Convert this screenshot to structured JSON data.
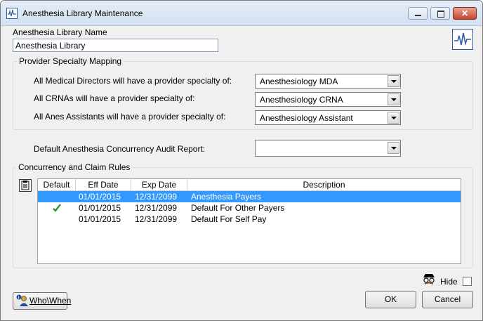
{
  "window": {
    "title": "Anesthesia Library Maintenance"
  },
  "library": {
    "name_label": "Anesthesia Library Name",
    "name_value": "Anesthesia Library"
  },
  "mapping": {
    "group_title": "Provider Specialty Mapping",
    "rows": [
      {
        "label": "All Medical Directors will have a provider specialty of:",
        "value": "Anesthesiology MDA"
      },
      {
        "label": "All CRNAs will have a provider specialty of:",
        "value": "Anesthesiology CRNA"
      },
      {
        "label": "All Anes Assistants will have a provider specialty of:",
        "value": "Anesthesiology Assistant"
      }
    ]
  },
  "audit": {
    "label": "Default Anesthesia Concurrency Audit Report:",
    "value": ""
  },
  "rules": {
    "group_title": "Concurrency and Claim Rules",
    "columns": [
      "Default",
      "Eff Date",
      "Exp Date",
      "Description"
    ],
    "rows": [
      {
        "default": false,
        "eff": "01/01/2015",
        "exp": "12/31/2099",
        "desc": "Anesthesia Payers",
        "selected": true
      },
      {
        "default": true,
        "eff": "01/01/2015",
        "exp": "12/31/2099",
        "desc": "Default For Other Payers",
        "selected": false
      },
      {
        "default": false,
        "eff": "01/01/2015",
        "exp": "12/31/2099",
        "desc": "Default For Self Pay",
        "selected": false
      }
    ]
  },
  "footer": {
    "hide_label": "Hide",
    "whowhen_label": "Who\\When",
    "ok_label": "OK",
    "cancel_label": "Cancel"
  },
  "colors": {
    "selection": "#3399ff",
    "check": "#2e9a2e"
  },
  "icons": {
    "app": "ekg-icon",
    "heart": "ekg-icon",
    "side": "notes-icon",
    "hide": "spy-icon",
    "whowhen": "info-person-icon",
    "default_check": "checkmark-icon"
  }
}
